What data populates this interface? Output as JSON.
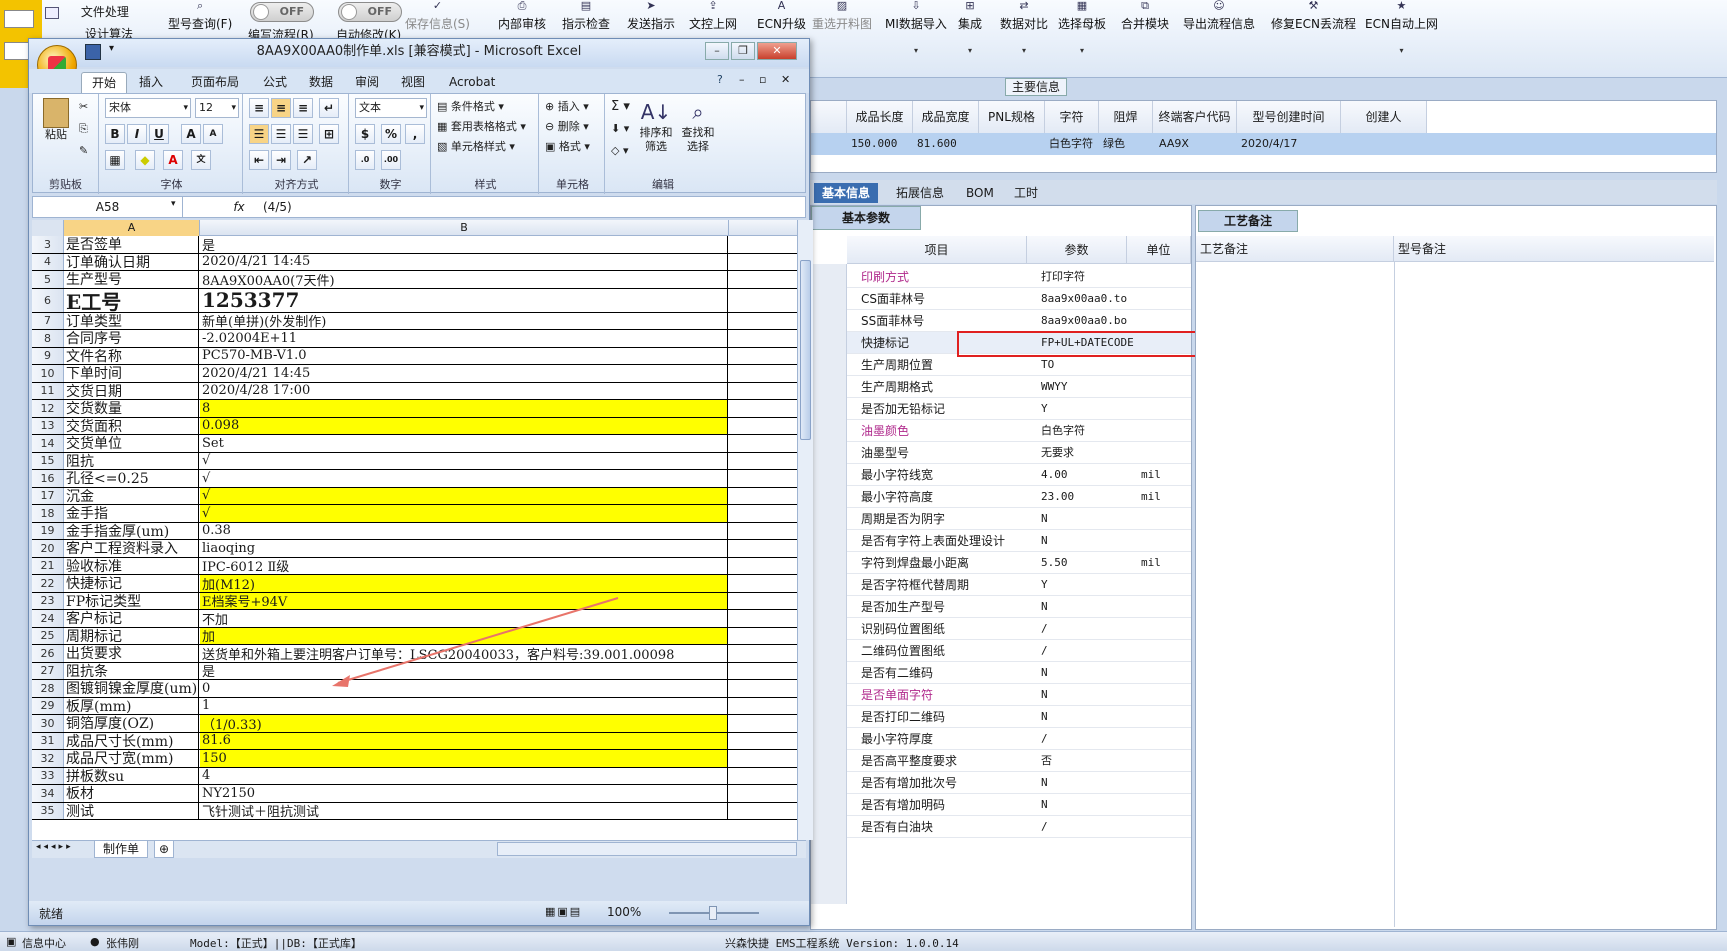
{
  "erp": {
    "top_left": {
      "menu1": "文件处理",
      "menu2": "设计算法"
    },
    "toggles": [
      {
        "state": "OFF",
        "label": "编写流程(R)"
      },
      {
        "state": "OFF",
        "label": "自动修改(K)"
      }
    ],
    "toolbar": [
      {
        "label": "型号查询(F)",
        "icon": "search-icon",
        "enabled": true,
        "dropdown": false
      },
      {
        "label": "保存信息(S)",
        "icon": "check-icon",
        "enabled": false,
        "dropdown": false
      },
      {
        "label": "内部审核",
        "icon": "printer-icon",
        "enabled": true,
        "dropdown": false
      },
      {
        "label": "指示检查",
        "icon": "doc-icon",
        "enabled": true,
        "dropdown": false
      },
      {
        "label": "发送指示",
        "icon": "send-icon",
        "enabled": true,
        "dropdown": false
      },
      {
        "label": "文控上网",
        "icon": "upload-icon",
        "enabled": true,
        "dropdown": false
      },
      {
        "label": "ECN升级",
        "icon": "a-icon",
        "enabled": true,
        "dropdown": false
      },
      {
        "label": "重选开料图",
        "icon": "image-icon",
        "enabled": false,
        "dropdown": false
      },
      {
        "label": "MI数据导入",
        "icon": "import-icon",
        "enabled": true,
        "dropdown": true
      },
      {
        "label": "集成",
        "icon": "integrate-icon",
        "enabled": true,
        "dropdown": true
      },
      {
        "label": "数据对比",
        "icon": "compare-icon",
        "enabled": true,
        "dropdown": true
      },
      {
        "label": "选择母板",
        "icon": "board-icon",
        "enabled": true,
        "dropdown": true
      },
      {
        "label": "合并模块",
        "icon": "merge-icon",
        "enabled": true,
        "dropdown": false
      },
      {
        "label": "导出流程信息",
        "icon": "smile-icon",
        "enabled": true,
        "dropdown": false
      },
      {
        "label": "修复ECN丢流程",
        "icon": "wrench-icon",
        "enabled": true,
        "dropdown": false
      },
      {
        "label": "ECN自动上网",
        "icon": "star-icon",
        "enabled": true,
        "dropdown": true
      }
    ],
    "main_info_label": "主要信息",
    "main_grid": {
      "headers": [
        "成品长度",
        "成品宽度",
        "PNL规格",
        "字符",
        "阻焊",
        "终端客户代码",
        "型号创建时间",
        "创建人"
      ],
      "row": [
        "150.000",
        "81.600",
        "",
        "白色字符",
        "绿色",
        "AA9X",
        "2020/4/17",
        ""
      ]
    },
    "lower_tabs": [
      "基本信息",
      "拓展信息",
      "BOM",
      "工时"
    ],
    "active_lower_tab": 0,
    "param_panel": {
      "title": "基本参数",
      "headers": [
        "项目",
        "参数",
        "单位"
      ],
      "rows": [
        {
          "item": "印刷方式",
          "value": "打印字符",
          "unit": "",
          "pink": true
        },
        {
          "item": "CS面菲林号",
          "value": "8aa9x00aa0.to",
          "unit": "",
          "pink": false
        },
        {
          "item": "SS面菲林号",
          "value": "8aa9x00aa0.bo",
          "unit": "",
          "pink": false
        },
        {
          "item": "快捷标记",
          "value": "FP+UL+DATECODE",
          "unit": "",
          "pink": false
        },
        {
          "item": "生产周期位置",
          "value": "TO",
          "unit": "",
          "pink": false
        },
        {
          "item": "生产周期格式",
          "value": "WWYY",
          "unit": "",
          "pink": false
        },
        {
          "item": "是否加无铅标记",
          "value": "Y",
          "unit": "",
          "pink": false
        },
        {
          "item": "油墨颜色",
          "value": "白色字符",
          "unit": "",
          "pink": true
        },
        {
          "item": "油墨型号",
          "value": "无要求",
          "unit": "",
          "pink": false
        },
        {
          "item": "最小字符线宽",
          "value": "4.00",
          "unit": "mil",
          "pink": false
        },
        {
          "item": "最小字符高度",
          "value": "23.00",
          "unit": "mil",
          "pink": false
        },
        {
          "item": "周期是否为阴字",
          "value": "N",
          "unit": "",
          "pink": false
        },
        {
          "item": "是否有字符上表面处理设计",
          "value": "N",
          "unit": "",
          "pink": false
        },
        {
          "item": "字符到焊盘最小距离",
          "value": "5.50",
          "unit": "mil",
          "pink": false
        },
        {
          "item": "是否字符框代替周期",
          "value": "Y",
          "unit": "",
          "pink": false
        },
        {
          "item": "是否加生产型号",
          "value": "N",
          "unit": "",
          "pink": false
        },
        {
          "item": "识别码位置图纸",
          "value": "/",
          "unit": "",
          "pink": false
        },
        {
          "item": "二维码位置图纸",
          "value": "/",
          "unit": "",
          "pink": false
        },
        {
          "item": "是否有二维码",
          "value": "N",
          "unit": "",
          "pink": false
        },
        {
          "item": "是否单面字符",
          "value": "N",
          "unit": "",
          "pink": true
        },
        {
          "item": "是否打印二维码",
          "value": "N",
          "unit": "",
          "pink": false
        },
        {
          "item": "最小字符厚度",
          "value": "/",
          "unit": "",
          "pink": false
        },
        {
          "item": "是否高平整度要求",
          "value": "否",
          "unit": "",
          "pink": false
        },
        {
          "item": "是否有增加批次号",
          "value": "N",
          "unit": "",
          "pink": false
        },
        {
          "item": "是否有增加明码",
          "value": "N",
          "unit": "",
          "pink": false
        },
        {
          "item": "是否有白油块",
          "value": "/",
          "unit": "",
          "pink": false
        }
      ]
    },
    "remarks": {
      "tab": "工艺备注",
      "col1": "工艺备注",
      "col2": "型号备注"
    },
    "status": {
      "info_center": "信息中心",
      "user": "张伟刚",
      "model": "Model:【正式】||DB:【正式库】",
      "app": "兴森快捷 EMS工程系统 Version: 1.0.0.14"
    },
    "colors": {
      "highlight_box": "#e02020",
      "active_tab": "#3a6db0",
      "selected_row": "#b7d1f0"
    }
  },
  "excel": {
    "title": "8AA9X00AA0制作单.xls  [兼容模式] - Microsoft Excel",
    "ribbon_tabs": [
      "开始",
      "插入",
      "页面布局",
      "公式",
      "数据",
      "审阅",
      "视图",
      "Acrobat"
    ],
    "active_ribbon_tab": 0,
    "ribbon": {
      "clipboard": {
        "paste": "粘贴",
        "group": "剪贴板"
      },
      "font": {
        "name": "宋体",
        "size": "12",
        "group": "字体",
        "bold": "B",
        "italic": "I",
        "underline": "U"
      },
      "align": {
        "group": "对齐方式"
      },
      "number": {
        "format": "文本",
        "group": "数字"
      },
      "styles": {
        "cond": "条件格式",
        "table": "套用表格格式",
        "cell": "单元格样式",
        "group": "样式"
      },
      "cells": {
        "insert": "插入",
        "delete": "删除",
        "format": "格式",
        "group": "单元格"
      },
      "edit": {
        "sort": "排序和筛选",
        "find": "查找和选择",
        "group": "编辑"
      }
    },
    "name_box": "A58",
    "formula": "(4/5)",
    "columns": [
      "A",
      "B"
    ],
    "rows": [
      {
        "n": "3",
        "a": "是否签单",
        "b": "是",
        "yellow": false,
        "big": false
      },
      {
        "n": "4",
        "a": "订单确认日期",
        "b": "2020/4/21 14:45",
        "yellow": false,
        "big": false
      },
      {
        "n": "5",
        "a": "生产型号",
        "b": "8AA9X00AA0(7天件)",
        "yellow": false,
        "big": false
      },
      {
        "n": "6",
        "a": "E工号",
        "b": "1253377",
        "yellow": false,
        "big": true
      },
      {
        "n": "7",
        "a": "订单类型",
        "b": "新单(单拼)(外发制作)",
        "yellow": false,
        "big": false
      },
      {
        "n": "8",
        "a": "合同序号",
        "b": "-2.02004E+11",
        "yellow": false,
        "big": false
      },
      {
        "n": "9",
        "a": "文件名称",
        "b": "PC570-MB-V1.0",
        "yellow": false,
        "big": false
      },
      {
        "n": "10",
        "a": "下单时间",
        "b": "2020/4/21 14:45",
        "yellow": false,
        "big": false
      },
      {
        "n": "11",
        "a": "交货日期",
        "b": "2020/4/28 17:00",
        "yellow": false,
        "big": false
      },
      {
        "n": "12",
        "a": "交货数量",
        "b": "8",
        "yellow": true,
        "big": false
      },
      {
        "n": "13",
        "a": "交货面积",
        "b": "0.098",
        "yellow": true,
        "big": false
      },
      {
        "n": "14",
        "a": "交货单位",
        "b": "Set",
        "yellow": false,
        "big": false
      },
      {
        "n": "15",
        "a": "阻抗",
        "b": "√",
        "yellow": false,
        "big": false
      },
      {
        "n": "16",
        "a": "孔径<=0.25",
        "b": "√",
        "yellow": false,
        "big": false
      },
      {
        "n": "17",
        "a": "沉金",
        "b": "√",
        "yellow": true,
        "big": false
      },
      {
        "n": "18",
        "a": "金手指",
        "b": "√",
        "yellow": true,
        "big": false
      },
      {
        "n": "19",
        "a": "金手指金厚(um)",
        "b": "0.38",
        "yellow": false,
        "big": false
      },
      {
        "n": "20",
        "a": "客户工程资料录入",
        "b": "liaoqing",
        "yellow": false,
        "big": false
      },
      {
        "n": "21",
        "a": "验收标准",
        "b": "IPC-6012 Ⅱ级",
        "yellow": false,
        "big": false
      },
      {
        "n": "22",
        "a": "快捷标记",
        "b": "加(M12)",
        "yellow": true,
        "big": false
      },
      {
        "n": "23",
        "a": "FP标记类型",
        "b": "E档案号+94V",
        "yellow": true,
        "big": false
      },
      {
        "n": "24",
        "a": "客户标记",
        "b": "不加",
        "yellow": false,
        "big": false
      },
      {
        "n": "25",
        "a": "周期标记",
        "b": "加",
        "yellow": true,
        "big": false
      },
      {
        "n": "26",
        "a": "出货要求",
        "b": "送货单和外箱上要注明客户订单号：LSCG20040033，客户料号:39.001.00098",
        "yellow": false,
        "big": false
      },
      {
        "n": "27",
        "a": "阻抗条",
        "b": "是",
        "yellow": false,
        "big": false
      },
      {
        "n": "28",
        "a": "图镀铜镍金厚度(um)",
        "b": "0",
        "yellow": false,
        "big": false
      },
      {
        "n": "29",
        "a": "板厚(mm)",
        "b": "1",
        "yellow": false,
        "big": false
      },
      {
        "n": "30",
        "a": "铜箔厚度(OZ)",
        "b": "（1/0.33)",
        "yellow": true,
        "big": false
      },
      {
        "n": "31",
        "a": "成品尺寸长(mm)",
        "b": "81.6",
        "yellow": true,
        "big": false
      },
      {
        "n": "32",
        "a": "成品尺寸宽(mm)",
        "b": "150",
        "yellow": true,
        "big": false
      },
      {
        "n": "33",
        "a": "拼板数su",
        "b": "4",
        "yellow": false,
        "big": false
      },
      {
        "n": "34",
        "a": "板材",
        "b": "NY2150",
        "yellow": false,
        "big": false
      },
      {
        "n": "35",
        "a": "测试",
        "b": "飞针测试＋阻抗测试",
        "yellow": false,
        "big": false
      }
    ],
    "sheet_tab": "制作单",
    "status": "就绪",
    "zoom": "100%"
  }
}
